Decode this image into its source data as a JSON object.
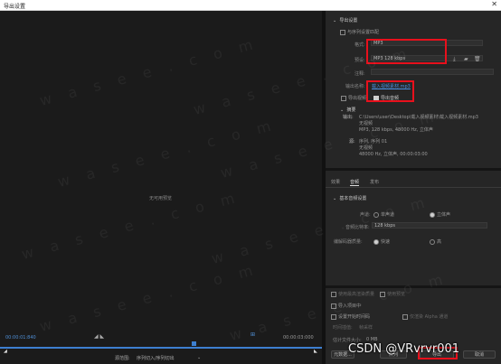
{
  "window": {
    "title": "导出设置",
    "close_glyph": "✕"
  },
  "preview": {
    "no_preview": "无可用预览",
    "time_start": "00:00:01:840",
    "time_end": "00:00:03:000",
    "source_range_label": "源范围:",
    "source_range_value": "序列切入/序列切出"
  },
  "export_settings": {
    "section_title": "导出设置",
    "match_sequence_label": "与序列设置匹配",
    "format_label": "格式:",
    "format_value": "MP3",
    "preset_label": "预设:",
    "preset_value": "MP3 128 kbps",
    "comments_label": "注释:",
    "output_name_label": "输出名称:",
    "output_name_value": "载入视频素材.mp3",
    "export_video_label": "导出视频",
    "export_audio_label": "导出音频"
  },
  "summary": {
    "title": "摘要",
    "output_label": "输出:",
    "output_lines": [
      "C:\\Users\\user\\Desktop\\载入视频素材\\载入视频素材.mp3",
      "无视频",
      "MP3, 128 kbps, 48000 Hz, 立体声"
    ],
    "source_label": "源:",
    "source_lines": [
      "序列, 序列 01",
      "无视频",
      "48000 Hz, 立体声, 00:00:03:00"
    ]
  },
  "tabs": [
    "效果",
    "音频",
    "发布"
  ],
  "active_tab": "音频",
  "basic_audio": {
    "title": "基本音频设置",
    "channels_label": "声道:",
    "mono_label": "单声道",
    "stereo_label": "立体声",
    "bitrate_label": "音频比特率:",
    "bitrate_value": "128 kbps",
    "quality_label": "编解码器质量:",
    "fast_label": "快速",
    "high_label": "高"
  },
  "bottom": {
    "max_render": "使用最高渲染质量",
    "use_previews": "使用预览",
    "import_project": "导入项目中",
    "set_start_timecode": "设置开始时间码",
    "render_alpha": "仅渲染 Alpha 通道",
    "interpolation_label": "时间插值:",
    "interpolation_value": "帧采样",
    "file_size_label": "估计文件大小:",
    "file_size_value": "0 MB",
    "metadata_button": "元数据...",
    "queue_button": "队列",
    "export_button": "导出",
    "cancel_button": "取消"
  },
  "overlay": {
    "watermark_text": "w a s e e . c o m",
    "csdn_text": "CSDN @VRvrvr001"
  },
  "colors": {
    "accent": "#3d7fd0",
    "highlight": "#e8101c",
    "link": "#4a90e2"
  }
}
